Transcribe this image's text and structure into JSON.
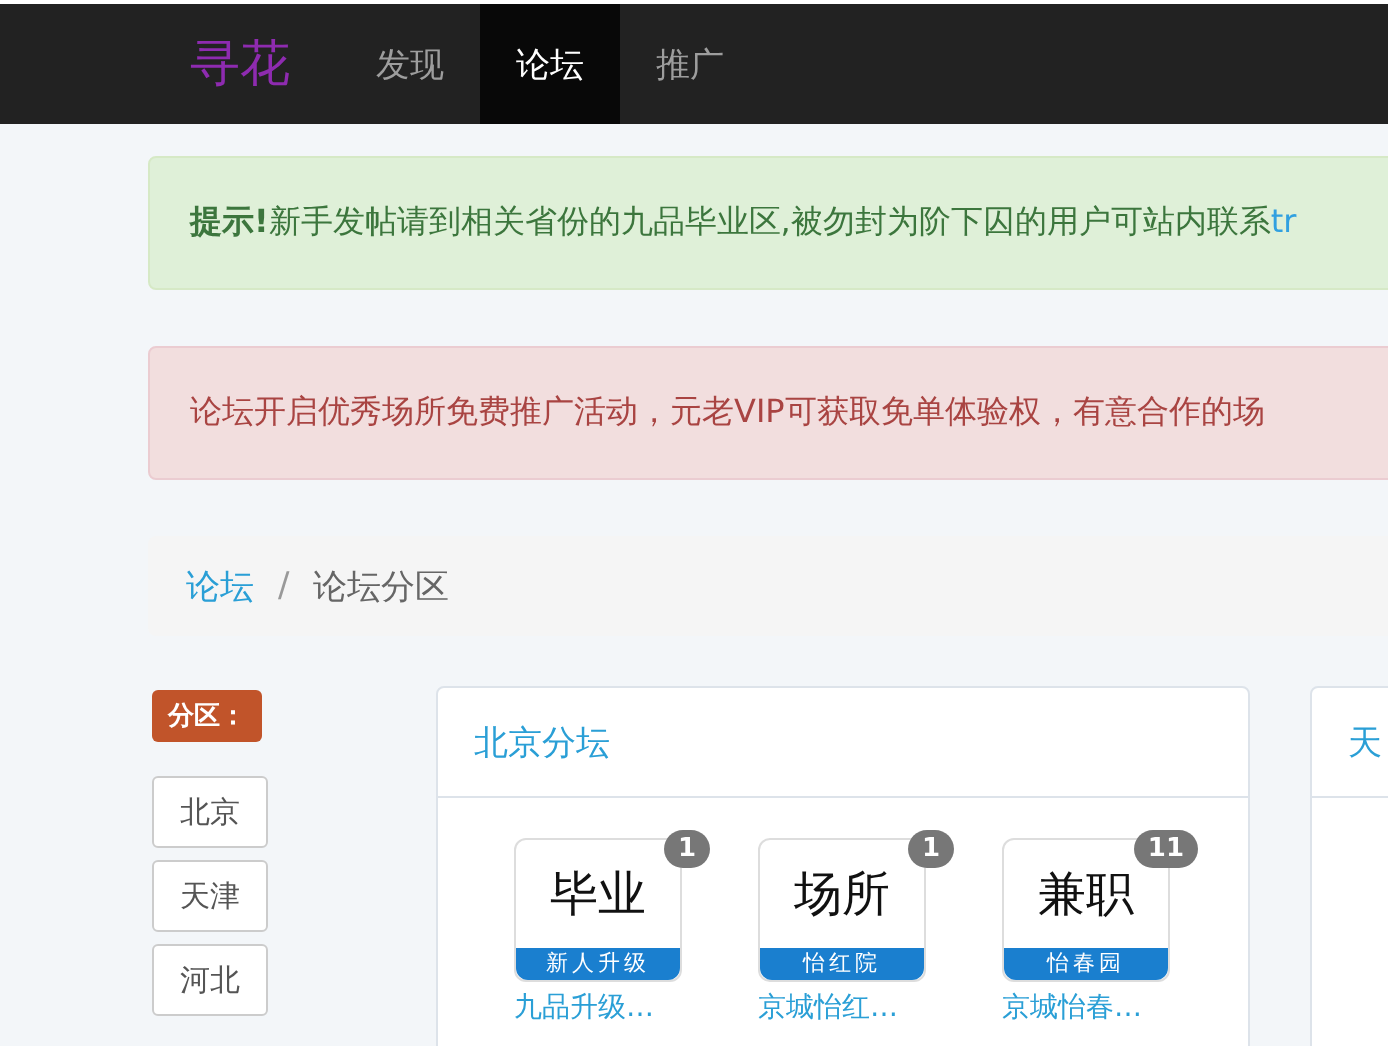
{
  "navbar": {
    "brand": "寻花",
    "items": [
      {
        "label": "发现",
        "selected": false
      },
      {
        "label": "论坛",
        "selected": true
      },
      {
        "label": "推广",
        "selected": false
      }
    ]
  },
  "alerts": [
    {
      "kind": "success",
      "strong": "提示!",
      "text": "新手发帖请到相关省份的九品毕业区,被勿封为阶下囚的用户可站内联系",
      "link": "tr"
    },
    {
      "kind": "danger",
      "text": "论坛开启优秀场所免费推广活动，元老VIP可获取免单体验权，有意合作的场"
    }
  ],
  "breadcrumb": {
    "separator": "/",
    "items": [
      {
        "label": "论坛",
        "link": true
      },
      {
        "label": "论坛分区",
        "link": false
      }
    ]
  },
  "sidebar": {
    "label": "分区：",
    "items": [
      {
        "label": "北京"
      },
      {
        "label": "天津"
      },
      {
        "label": "河北"
      }
    ]
  },
  "cards": [
    {
      "title": "北京分坛",
      "forums": [
        {
          "icon_text": "毕业",
          "icon_caption": "新人升级",
          "badge": "1",
          "name": "九品升级…"
        },
        {
          "icon_text": "场所",
          "icon_caption": "怡红院",
          "badge": "1",
          "name": "京城怡红…"
        },
        {
          "icon_text": "兼职",
          "icon_caption": "怡春园",
          "badge": "11",
          "name": "京城怡春…"
        }
      ]
    },
    {
      "title": "天"
    }
  ]
}
